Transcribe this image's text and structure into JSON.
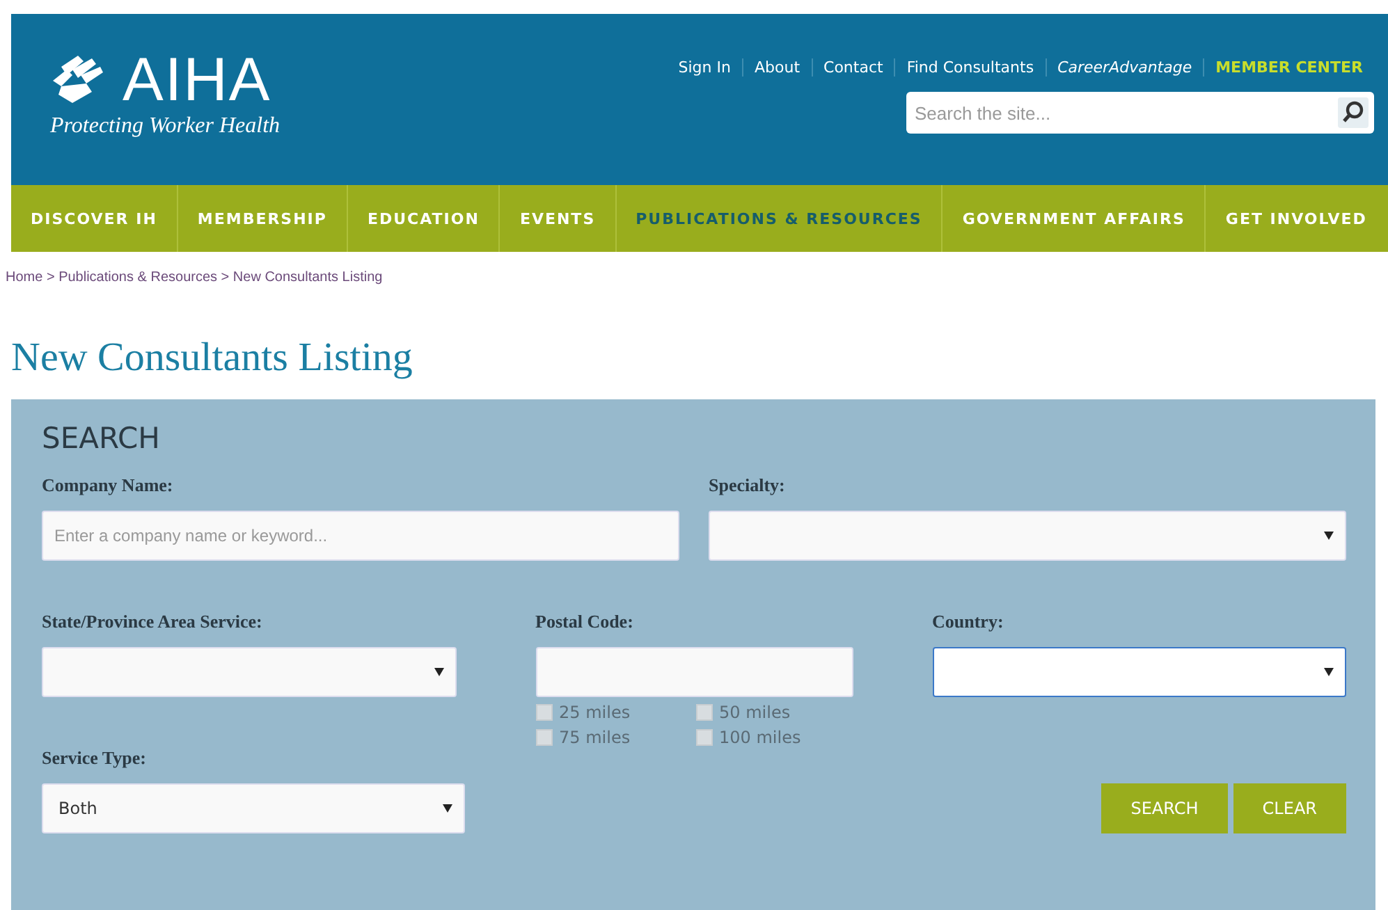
{
  "header": {
    "logo_text": "AIHA",
    "tagline": "Protecting Worker Health",
    "top_links": [
      {
        "label": "Sign In",
        "kind": "plain"
      },
      {
        "label": "About",
        "kind": "plain"
      },
      {
        "label": "Contact",
        "kind": "plain"
      },
      {
        "label": "Find Consultants",
        "kind": "plain"
      },
      {
        "label": "CareerAdvantage",
        "kind": "italic"
      },
      {
        "label": "MEMBER CENTER",
        "kind": "highlight"
      }
    ],
    "search": {
      "placeholder": "Search the site..."
    }
  },
  "nav": [
    {
      "label": "DISCOVER IH",
      "selected": false
    },
    {
      "label": "MEMBERSHIP",
      "selected": false
    },
    {
      "label": "EDUCATION",
      "selected": false
    },
    {
      "label": "EVENTS",
      "selected": false
    },
    {
      "label": "PUBLICATIONS & RESOURCES",
      "selected": true
    },
    {
      "label": "GOVERNMENT AFFAIRS",
      "selected": false
    },
    {
      "label": "GET INVOLVED",
      "selected": false
    }
  ],
  "breadcrumb": "Home > Publications & Resources > New Consultants Listing",
  "page_title": "New Consultants Listing",
  "search_panel": {
    "title": "SEARCH",
    "company_name": {
      "label": "Company Name:",
      "placeholder": "Enter a company name or keyword..."
    },
    "specialty": {
      "label": "Specialty:",
      "focused": false
    },
    "state": {
      "label": "State/Province Area Service:",
      "focused": false
    },
    "postal_code": {
      "label": "Postal Code:"
    },
    "distances": [
      {
        "label": "25 miles",
        "checked": false
      },
      {
        "label": "50 miles",
        "checked": false
      },
      {
        "label": "75 miles",
        "checked": false
      },
      {
        "label": "100 miles",
        "checked": false
      }
    ],
    "country": {
      "label": "Country:",
      "focused": true
    },
    "service_type": {
      "label": "Service Type:",
      "value": "Both",
      "focused": false
    },
    "buttons": [
      "SEARCH",
      "CLEAR"
    ]
  }
}
